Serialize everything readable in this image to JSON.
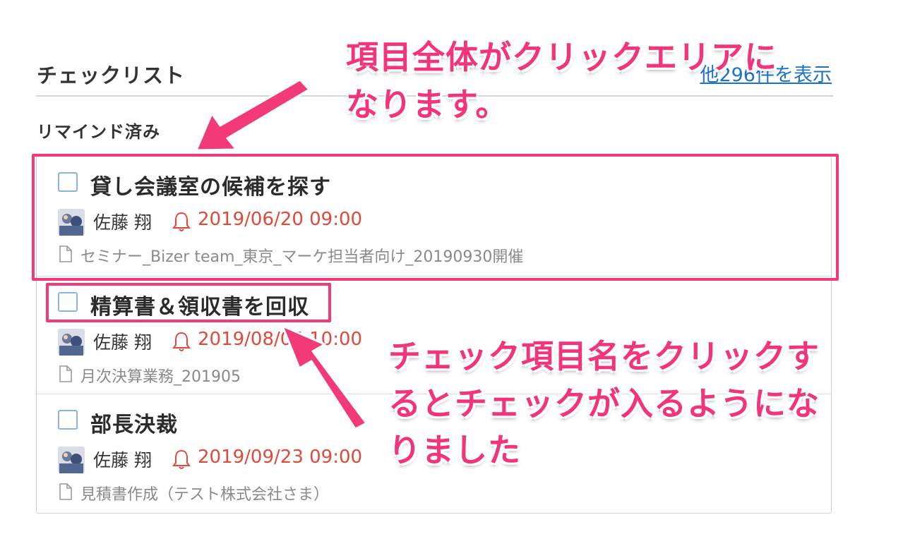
{
  "header": {
    "title": "チェックリスト",
    "more_link": "他296件を表示"
  },
  "group": {
    "label": "リマインド済み"
  },
  "items": [
    {
      "title": "貸し会議室の候補を探す",
      "assignee": "佐藤 翔",
      "reminder": "2019/06/20 09:00",
      "project": "セミナー_Bizer team_東京_マーケ担当者向け_20190930開催",
      "checked": false
    },
    {
      "title": "精算書＆領収書を回収",
      "assignee": "佐藤 翔",
      "reminder": "2019/08/05 10:00",
      "project": "月次決算業務_201905",
      "checked": false
    },
    {
      "title": "部長決裁",
      "assignee": "佐藤 翔",
      "reminder": "2019/09/23 09:00",
      "project": "見積書作成（テスト株式会社さま）",
      "checked": false
    }
  ],
  "annotations": {
    "area_note_line1": "項目全体がクリックエリアに",
    "area_note_line2": "なります。",
    "title_note_line1": "チェック項目名をクリックす",
    "title_note_line2": "るとチェックが入るようにな",
    "title_note_line3": "りました",
    "color": "#f23a78"
  },
  "colors": {
    "link": "#1a73c8",
    "reminder": "#e04a3b",
    "checkbox_border": "#8ab4e0"
  },
  "icons": {
    "reminder": "bell-icon",
    "project": "document-icon",
    "avatar": "user-avatar"
  }
}
